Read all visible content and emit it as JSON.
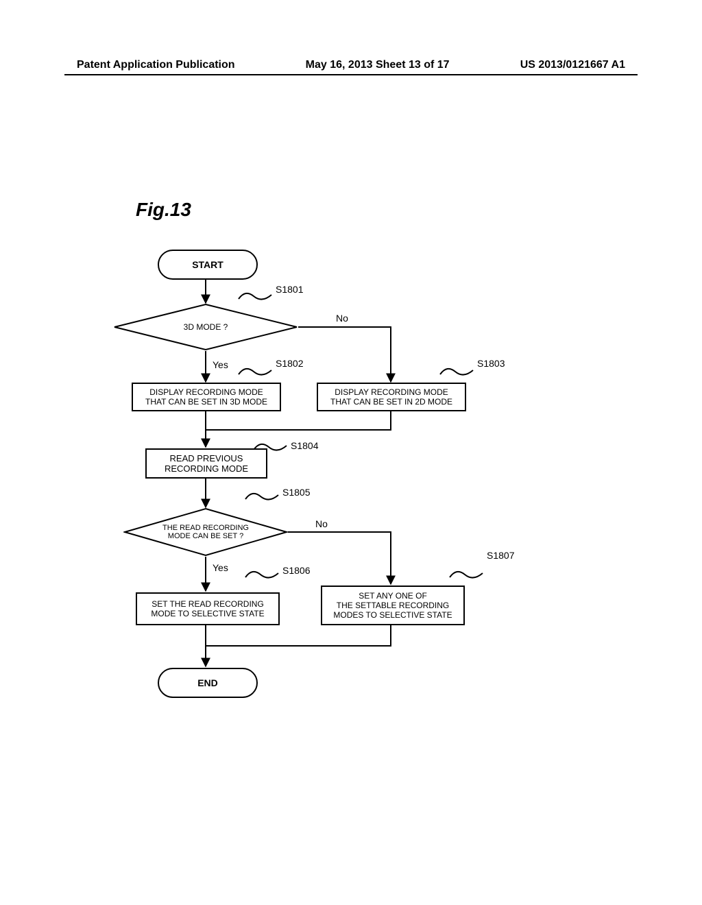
{
  "header": {
    "left": "Patent Application Publication",
    "center": "May 16, 2013  Sheet 13 of 17",
    "right": "US 2013/0121667 A1"
  },
  "figure_label": "Fig.13",
  "flowchart": {
    "start": "START",
    "end": "END",
    "d1": {
      "text": "3D MODE ?",
      "ref": "S1801",
      "yes": "Yes",
      "no": "No"
    },
    "p2": {
      "text": "DISPLAY RECORDING MODE\nTHAT CAN BE SET IN 3D MODE",
      "ref": "S1802"
    },
    "p3": {
      "text": "DISPLAY RECORDING MODE\nTHAT CAN BE SET IN 2D MODE",
      "ref": "S1803"
    },
    "p4": {
      "text": "READ PREVIOUS\nRECORDING MODE",
      "ref": "S1804"
    },
    "d5": {
      "text": "THE READ RECORDING\nMODE CAN BE SET ?",
      "ref": "S1805",
      "yes": "Yes",
      "no": "No"
    },
    "p6": {
      "text": "SET THE READ RECORDING\nMODE TO SELECTIVE STATE",
      "ref": "S1806"
    },
    "p7": {
      "text": "SET ANY ONE OF\nTHE SETTABLE RECORDING\nMODES TO SELECTIVE STATE",
      "ref": "S1807"
    }
  }
}
